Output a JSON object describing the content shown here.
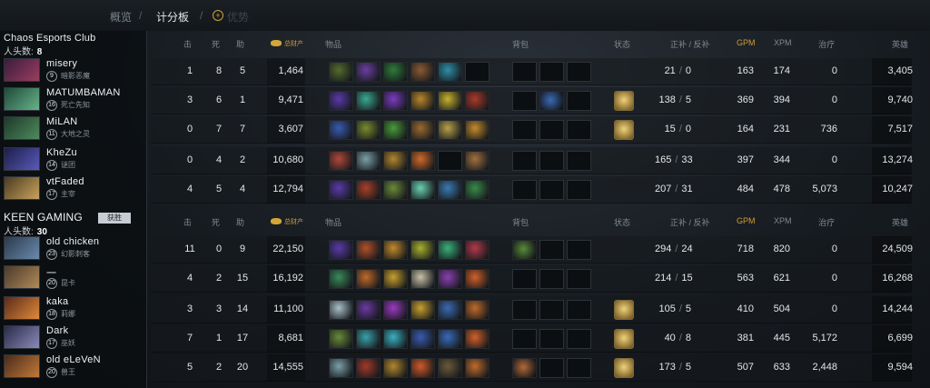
{
  "tabs": {
    "overview": "概览",
    "sep1": "/",
    "scoreboard": "计分板",
    "sep2": "/",
    "faded": "优势"
  },
  "teams": [
    {
      "name": "Chaos Esports Club",
      "kills_label": "人头数:",
      "kills": "8",
      "headers": {
        "k": "击",
        "d": "死",
        "a": "助",
        "networth": "总财产",
        "items": "物品",
        "backpack": "背包",
        "status": "状态",
        "lhdn": "正补 / 反补",
        "gpm": "GPM",
        "xpm": "XPM",
        "heal": "治疗",
        "hd": "英雄"
      },
      "players": [
        {
          "name": "misery",
          "level": "9",
          "hero": "暗影恶魔",
          "k": "1",
          "d": "8",
          "a": "5",
          "networth": "1,464",
          "lh": "21",
          "dn": "0",
          "gpm": "163",
          "xpm": "174",
          "heal": "0",
          "hd": "3,405",
          "neutral": false,
          "portrait": [
            "#3a1c3e",
            "#9a3e5e"
          ],
          "items": [
            "#556b2f",
            "#6a3fa0",
            "#2f7a3a",
            "#8a5a32",
            "#2e8fa8",
            ""
          ],
          "backpack": [
            "",
            "",
            ""
          ]
        },
        {
          "name": "MATUMBAMAN",
          "level": "16",
          "hero": "死亡先知",
          "k": "3",
          "d": "6",
          "a": "1",
          "networth": "9,471",
          "lh": "138",
          "dn": "5",
          "gpm": "369",
          "xpm": "394",
          "heal": "0",
          "hd": "9,740",
          "neutral": true,
          "portrait": [
            "#1f4a3a",
            "#68b38a"
          ],
          "items": [
            "#5a3aa8",
            "#3ba890",
            "#7a3cc0",
            "#b8862a",
            "#c6b22e",
            "#a83a2a"
          ],
          "backpack": [
            "",
            "#3c6ab4",
            ""
          ]
        },
        {
          "name": "MiLAN",
          "level": "11",
          "hero": "大地之灵",
          "k": "0",
          "d": "7",
          "a": "7",
          "networth": "3,607",
          "lh": "15",
          "dn": "0",
          "gpm": "164",
          "xpm": "231",
          "heal": "736",
          "hd": "7,517",
          "neutral": true,
          "portrait": [
            "#1d3a2a",
            "#4f8a5c"
          ],
          "items": [
            "#3a5ab0",
            "#7a8a2e",
            "#4a9a3a",
            "#9a6a30",
            "#b8a04a",
            "#c48a2e"
          ],
          "backpack": [
            "",
            "",
            ""
          ]
        },
        {
          "name": "KheZu",
          "level": "14",
          "hero": "谜团",
          "k": "0",
          "d": "4",
          "a": "2",
          "networth": "10,680",
          "lh": "165",
          "dn": "33",
          "gpm": "397",
          "xpm": "344",
          "heal": "0",
          "hd": "13,274",
          "neutral": false,
          "portrait": [
            "#1c1e4a",
            "#5a5ab8"
          ],
          "items": [
            "#b0483a",
            "#7aa0a8",
            "#b0862e",
            "#d06a2a",
            "",
            "#a07040"
          ],
          "backpack": [
            "",
            "",
            ""
          ]
        },
        {
          "name": "vtFaded",
          "level": "17",
          "hero": "主宰",
          "k": "4",
          "d": "5",
          "a": "4",
          "networth": "12,794",
          "lh": "207",
          "dn": "31",
          "gpm": "484",
          "xpm": "478",
          "heal": "5,073",
          "hd": "10,247",
          "neutral": false,
          "portrait": [
            "#4a3a22",
            "#c9a35c"
          ],
          "items": [
            "#5a3aa8",
            "#a8402a",
            "#6a8a3a",
            "#6ad0b0",
            "#3a7ab0",
            "#3a8a4a"
          ],
          "backpack": [
            "",
            "",
            ""
          ]
        }
      ]
    },
    {
      "name": "KEEN GAMING",
      "tag": "获胜",
      "kills_label": "人头数:",
      "kills": "30",
      "headers": {
        "k": "击",
        "d": "死",
        "a": "助",
        "networth": "总财产",
        "items": "物品",
        "backpack": "背包",
        "status": "状态",
        "lhdn": "正补 / 反补",
        "gpm": "GPM",
        "xpm": "XPM",
        "heal": "治疗",
        "hd": "英雄"
      },
      "players": [
        {
          "name": "old chicken",
          "level": "23",
          "hero": "幻影刺客",
          "k": "11",
          "d": "0",
          "a": "9",
          "networth": "22,150",
          "lh": "294",
          "dn": "24",
          "gpm": "718",
          "xpm": "820",
          "heal": "0",
          "hd": "24,509",
          "neutral": false,
          "portrait": [
            "#2a3a4a",
            "#6a8ab0"
          ],
          "items": [
            "#5a3aa8",
            "#b0502a",
            "#c08a2e",
            "#a8b02e",
            "#3ab07a",
            "#b03a4a"
          ],
          "backpack": [
            "#5a8a3a",
            "",
            ""
          ]
        },
        {
          "name": "一",
          "level": "20",
          "hero": "昆卡",
          "k": "4",
          "d": "2",
          "a": "15",
          "networth": "16,192",
          "lh": "214",
          "dn": "15",
          "gpm": "563",
          "xpm": "621",
          "heal": "0",
          "hd": "16,268",
          "neutral": false,
          "portrait": [
            "#4a3a2a",
            "#b08a5a"
          ],
          "items": [
            "#3a8a5a",
            "#c06a2a",
            "#c8a02e",
            "#c8c0a8",
            "#8a40b0",
            "#d0602a"
          ],
          "backpack": [
            "",
            "",
            ""
          ]
        },
        {
          "name": "kaka",
          "level": "18",
          "hero": "莉娜",
          "k": "3",
          "d": "3",
          "a": "14",
          "networth": "11,100",
          "lh": "105",
          "dn": "5",
          "gpm": "410",
          "xpm": "504",
          "heal": "0",
          "hd": "14,244",
          "neutral": true,
          "portrait": [
            "#5a2a1a",
            "#e08a3a"
          ],
          "items": [
            "#a8c0c8",
            "#6a3aa0",
            "#9a3ac0",
            "#c8a02e",
            "#3a6ab0",
            "#c06a2a"
          ],
          "backpack": [
            "",
            "",
            ""
          ]
        },
        {
          "name": "Dark",
          "level": "17",
          "hero": "巫妖",
          "k": "7",
          "d": "1",
          "a": "17",
          "networth": "8,681",
          "lh": "40",
          "dn": "8",
          "gpm": "381",
          "xpm": "445",
          "heal": "5,172",
          "hd": "6,699",
          "neutral": true,
          "portrait": [
            "#2a2a4a",
            "#8a8ab8"
          ],
          "items": [
            "#6a8a3a",
            "#3aa0a8",
            "#3ab0c0",
            "#3a5ab0",
            "#3a6ab8",
            "#d0602a"
          ],
          "backpack": [
            "",
            "",
            ""
          ]
        },
        {
          "name": "old eLeVeN",
          "level": "20",
          "hero": "兽王",
          "k": "5",
          "d": "2",
          "a": "20",
          "networth": "14,555",
          "lh": "173",
          "dn": "5",
          "gpm": "507",
          "xpm": "633",
          "heal": "2,448",
          "hd": "9,594",
          "neutral": true,
          "portrait": [
            "#4a2a1a",
            "#c07a3a"
          ],
          "items": [
            "#7aa0a8",
            "#a03a2a",
            "#b0862e",
            "#d05a2a",
            "#6a5a3a",
            "#c06a2a"
          ],
          "backpack": [
            "#b06a3a",
            "",
            ""
          ]
        }
      ]
    }
  ]
}
